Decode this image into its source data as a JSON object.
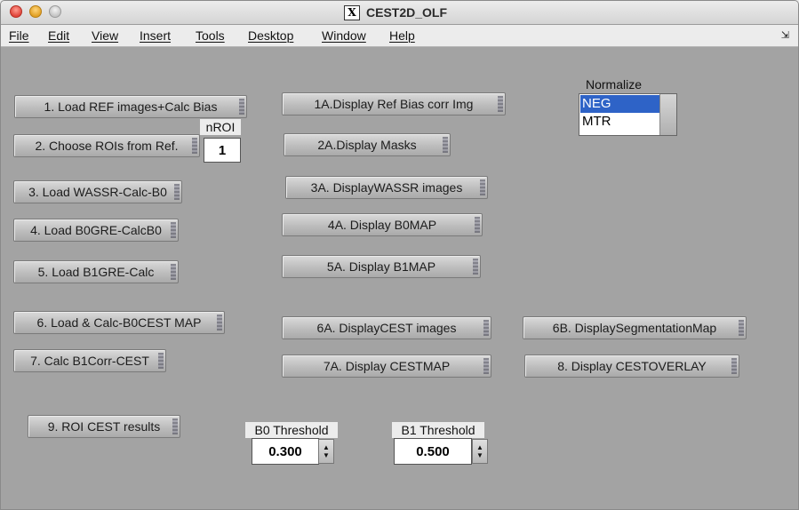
{
  "window": {
    "title": "CEST2D_OLF"
  },
  "menu": [
    "File",
    "Edit",
    "View",
    "Insert",
    "Tools",
    "Desktop",
    "Window",
    "Help"
  ],
  "menu_overflow_icon": "double-chevron-icon",
  "buttons": {
    "load_ref": "1. Load REF images+Calc Bias",
    "choose_rois": "2. Choose ROIs from Ref.",
    "load_wassr": "3. Load WASSR-Calc-B0",
    "load_b0gre": "4. Load B0GRE-CalcB0",
    "load_b1gre": "5. Load B1GRE-Calc",
    "load_calc_b0cest": "6. Load & Calc-B0CEST MAP",
    "calc_b1corr": "7. Calc B1Corr-CEST",
    "roi_results": "9. ROI CEST results",
    "display_ref_bias": "1A.Display Ref Bias corr Img",
    "display_masks": "2A.Display Masks",
    "display_wassr": "3A. DisplayWASSR images",
    "display_b0map": "4A. Display B0MAP",
    "display_b1map": "5A. Display B1MAP",
    "display_cest_images": "6A. DisplayCEST images",
    "display_cestmap": "7A. Display CESTMAP",
    "display_segmentation": "6B. DisplaySegmentationMap",
    "display_cest_overlay": "8. Display CESTOVERLAY"
  },
  "nroi": {
    "label": "nROI",
    "value": "1"
  },
  "normalize": {
    "label": "Normalize",
    "options": [
      "NEG",
      "MTR"
    ],
    "selected": "NEG"
  },
  "b0_threshold": {
    "label": "B0 Threshold",
    "value": "0.300"
  },
  "b1_threshold": {
    "label": "B1 Threshold",
    "value": "0.500"
  }
}
